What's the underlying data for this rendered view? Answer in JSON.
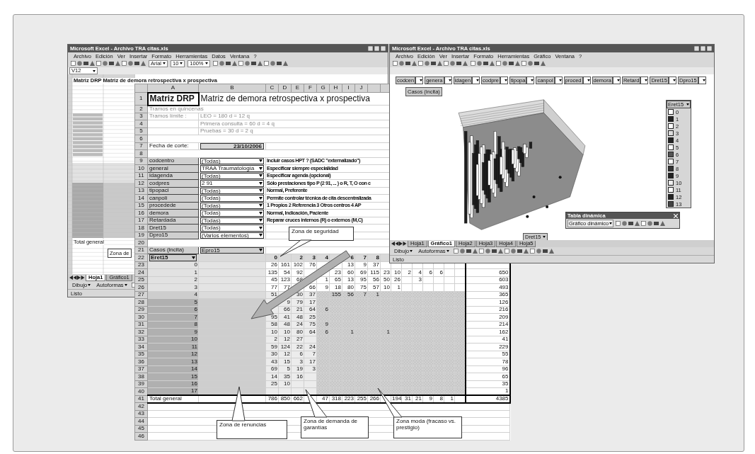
{
  "left_window": {
    "title": "Microsoft Excel - Archivo TRA citas.xls",
    "menu": [
      "Archivo",
      "Edición",
      "Ver",
      "Insertar",
      "Formato",
      "Herramientas",
      "Datos",
      "Ventana",
      "?"
    ],
    "name_box": "V12",
    "font": "Arial",
    "font_size": "10",
    "zoom": "100%",
    "mini_sheet": {
      "title": "Matriz DRP  Matriz de demora retrospectiva x prospectiva",
      "total_label": "Total general",
      "callout": "Zona de"
    },
    "sheet_tabs": [
      {
        "label": "Hoja1",
        "selected": true
      },
      {
        "label": "Gráfico1",
        "selected": false
      }
    ],
    "draw_toolbar": [
      "Dibujo",
      "Autoformas"
    ],
    "status": "Listo"
  },
  "sheet": {
    "columns": [
      "A",
      "B",
      "C",
      "D",
      "E",
      "F",
      "G",
      "H",
      "I",
      "J"
    ],
    "rows": [
      {
        "number": "1",
        "kind": "title",
        "a": "Matriz DRP",
        "b": "Matriz de demora retrospectiva x prospectiva"
      },
      {
        "number": "2",
        "kind": "note",
        "a": "Tramos en quincenas"
      },
      {
        "number": "3",
        "kind": "note",
        "a": "Tramos límite :",
        "b": "LEO = 180 d = 12 q"
      },
      {
        "number": "4",
        "kind": "note",
        "b": "Primera consulta = 60 d = 4 q"
      },
      {
        "number": "5",
        "kind": "note",
        "b": "Pruebas = 30 d = 2 q"
      },
      {
        "number": "6",
        "kind": "blank"
      },
      {
        "number": "7",
        "kind": "date",
        "a": "Fecha de corte:",
        "b": "23/10/2006"
      },
      {
        "number": "8",
        "kind": "blank"
      },
      {
        "number": "9",
        "kind": "filter",
        "a": "codcentro",
        "b": "(Todas)",
        "note": "Incluir casos HPT ? (SADC \"externalizado\")"
      },
      {
        "number": "10",
        "kind": "filter",
        "a": "general",
        "b": "TRAA Traumatología",
        "note": "Especificar siempre especialidad"
      },
      {
        "number": "11",
        "kind": "filter",
        "a": "idagenda",
        "b": "(Todas)",
        "note": "Especificar agenda (opcional)"
      },
      {
        "number": "12",
        "kind": "filter",
        "a": "codpres",
        "b": "2 91",
        "note": "Sólo prestaciones tipo P (2 91, ... ) o R, T, O con c"
      },
      {
        "number": "13",
        "kind": "filter",
        "a": "tipopaci",
        "b": "(Todas)",
        "note": "Normal, Preferente"
      },
      {
        "number": "14",
        "kind": "filter",
        "a": "canpoli",
        "b": "(Todas)",
        "note": "Permite controlar técnica de cita descentralizada"
      },
      {
        "number": "15",
        "kind": "filter",
        "a": "procedede",
        "b": "(Todas)",
        "note": "1 Propios 2 Referencia 3 Otros centros 4 AP"
      },
      {
        "number": "16",
        "kind": "filter",
        "a": "demora",
        "b": "(Todas)",
        "note": "Normal, Indicación, Paciente"
      },
      {
        "number": "17",
        "kind": "filter",
        "a": "Retardada",
        "b": "(Todas)",
        "note": "Reparar cruces internos (R) o externos (M,C)"
      },
      {
        "number": "18",
        "kind": "filter",
        "a": "Dret15",
        "b": "(Todas)"
      },
      {
        "number": "19",
        "kind": "filter",
        "a": "Dpro15",
        "b": "(Varios elementos)"
      },
      {
        "number": "20",
        "kind": "blank"
      },
      {
        "number": "21",
        "kind": "page",
        "a": "Casos (incita)",
        "b": "Epro15"
      },
      {
        "number": "22",
        "kind": "col_head",
        "a": "Eret15",
        "values": {
          "c0": "0",
          "c2": "2",
          "c3": "3",
          "c4": "4",
          "c6": "6",
          "c7": "7",
          "c8": "8"
        }
      },
      {
        "number": "23",
        "kind": "data",
        "a": "0",
        "color": "#e2e2e2",
        "values": {
          "c0": "26",
          "c1": "161",
          "c2": "102",
          "c3": "76",
          "c6": "13",
          "c7": "9",
          "c8": "37"
        }
      },
      {
        "number": "24",
        "kind": "data",
        "a": "1",
        "color": "#e2e2e2",
        "values": {
          "c0": "135",
          "c1": "54",
          "c2": "92",
          "c5": "23",
          "c6": "60",
          "c7": "69",
          "c8": "115",
          "c9": "23",
          "c10": "10",
          "c11": "2",
          "c12": "4",
          "c13": "6",
          "c14": "6"
        },
        "total": "650"
      },
      {
        "number": "25",
        "kind": "data",
        "a": "2",
        "color": "#e2e2e2",
        "values": {
          "c0": "45",
          "c1": "123",
          "c2": "68",
          "c4": "1",
          "c5": "65",
          "c6": "13",
          "c7": "95",
          "c8": "56",
          "c9": "50",
          "c10": "26",
          "c12": "3"
        },
        "total": "603"
      },
      {
        "number": "26",
        "kind": "data",
        "a": "3",
        "color": "#e2e2e2",
        "values": {
          "c0": "77",
          "c1": "77",
          "c3": "66",
          "c4": "9",
          "c5": "18",
          "c6": "80",
          "c7": "75",
          "c8": "57",
          "c9": "10",
          "c10": "1"
        },
        "total": "493"
      },
      {
        "number": "27",
        "kind": "data",
        "a": "4",
        "color": "#cdcdcd",
        "values": {
          "c0": "51",
          "c2": "30",
          "c3": "37",
          "c5": "155",
          "c6": "56",
          "c7": "7",
          "c8": "1"
        },
        "total": "365"
      },
      {
        "number": "28",
        "kind": "data",
        "a": "5",
        "color": "#b0b0b0",
        "values": {
          "c1": "9",
          "c2": "79",
          "c3": "17"
        },
        "total": "126"
      },
      {
        "number": "29",
        "kind": "data",
        "a": "6",
        "color": "#b0b0b0",
        "values": {
          "c1": "66",
          "c2": "21",
          "c3": "64",
          "c4": "6"
        },
        "total": "216"
      },
      {
        "number": "30",
        "kind": "data",
        "a": "7",
        "color": "#b0b0b0",
        "values": {
          "c0": "95",
          "c1": "41",
          "c2": "48",
          "c3": "25"
        },
        "total": "209"
      },
      {
        "number": "31",
        "kind": "data",
        "a": "8",
        "color": "#b0b0b0",
        "values": {
          "c0": "58",
          "c1": "48",
          "c2": "24",
          "c3": "75",
          "c4": "9"
        },
        "total": "214"
      },
      {
        "number": "32",
        "kind": "data",
        "a": "9",
        "color": "#b0b0b0",
        "values": {
          "c0": "10",
          "c1": "10",
          "c2": "80",
          "c3": "64",
          "c4": "6",
          "c6": "1",
          "c9": "1"
        },
        "total": "162"
      },
      {
        "number": "33",
        "kind": "data",
        "a": "10",
        "color": "#b0b0b0",
        "values": {
          "c0": "2",
          "c1": "12",
          "c2": "27"
        },
        "total": "41"
      },
      {
        "number": "34",
        "kind": "data",
        "a": "11",
        "color": "#b0b0b0",
        "values": {
          "c0": "59",
          "c1": "124",
          "c2": "22",
          "c3": "24"
        },
        "total": "229"
      },
      {
        "number": "35",
        "kind": "data",
        "a": "12",
        "color": "#b0b0b0",
        "values": {
          "c0": "30",
          "c1": "12",
          "c2": "6",
          "c3": "7"
        },
        "total": "55"
      },
      {
        "number": "36",
        "kind": "data",
        "a": "13",
        "color": "#b0b0b0",
        "values": {
          "c0": "43",
          "c1": "15",
          "c2": "3",
          "c3": "17"
        },
        "total": "78"
      },
      {
        "number": "37",
        "kind": "data",
        "a": "14",
        "color": "#b0b0b0",
        "values": {
          "c0": "69",
          "c1": "5",
          "c2": "19",
          "c3": "3"
        },
        "total": "96"
      },
      {
        "number": "38",
        "kind": "data",
        "a": "15",
        "color": "#b0b0b0",
        "values": {
          "c0": "14",
          "c1": "35",
          "c2": "16"
        },
        "total": "65"
      },
      {
        "number": "39",
        "kind": "data",
        "a": "16",
        "color": "#b0b0b0",
        "values": {
          "c0": "25",
          "c1": "10"
        },
        "total": "35"
      },
      {
        "number": "40",
        "kind": "data",
        "a": "17",
        "color": "#b0b0b0",
        "total": "1"
      },
      {
        "number": "41",
        "kind": "total",
        "a": "Total general",
        "values": {
          "c0": "786",
          "c1": "850",
          "c2": "662",
          "c4": "47",
          "c5": "318",
          "c6": "223",
          "c7": "255",
          "c8": "266",
          "c10": "194",
          "c11": "31",
          "c12": "21",
          "c13": "9",
          "c14": "8",
          "c15": "1"
        },
        "total": "4385"
      },
      {
        "number": "42",
        "kind": "blank"
      },
      {
        "number": "43",
        "kind": "blank"
      },
      {
        "number": "44",
        "kind": "blank"
      },
      {
        "number": "45",
        "kind": "blank"
      },
      {
        "number": "46",
        "kind": "blank"
      }
    ]
  },
  "right_window": {
    "title": "Microsoft Excel - Archivo TRA citas.xls",
    "menu": [
      "Archivo",
      "Edición",
      "Ver",
      "Insertar",
      "Formato",
      "Herramientas",
      "Gráfico",
      "Ventana",
      "?"
    ],
    "page_fields": [
      "codcen",
      "genera",
      "idagen",
      "codpre",
      "tipopa",
      "canpol",
      "proced",
      "demora",
      "Retard",
      "Dret15",
      "Dpro15"
    ],
    "series_field": "Casos (incita)",
    "legend": {
      "title": "Eret15",
      "items": [
        {
          "label": "0",
          "color": "#ffffff"
        },
        {
          "label": "1",
          "color": "#222222"
        },
        {
          "label": "2",
          "color": "#ffffff"
        },
        {
          "label": "3",
          "color": "#dddddd"
        },
        {
          "label": "4",
          "color": "#222222"
        },
        {
          "label": "5",
          "color": "#ffffff"
        },
        {
          "label": "6",
          "color": "#555555"
        },
        {
          "label": "7",
          "color": "#ffffff"
        },
        {
          "label": "8",
          "color": "#333333"
        },
        {
          "label": "9",
          "color": "#222222"
        },
        {
          "label": "10",
          "color": "#eeeeee"
        },
        {
          "label": "11",
          "color": "#ffffff"
        },
        {
          "label": "12",
          "color": "#222222"
        },
        {
          "label": "13",
          "color": "#444444"
        }
      ]
    },
    "category_field": "Dret15",
    "pivot_toolbar": {
      "title": "Tabla dinámica",
      "menu": "Gráfico dinámico"
    },
    "sheet_tabs": [
      {
        "label": "Hoja1",
        "selected": false
      },
      {
        "label": "Gráfico1",
        "selected": true
      },
      {
        "label": "Hoja2",
        "selected": false
      },
      {
        "label": "Hoja3",
        "selected": false
      },
      {
        "label": "Hoja4",
        "selected": false
      },
      {
        "label": "Hoja5",
        "selected": false
      }
    ],
    "draw_toolbar": [
      "Dibujo",
      "Autoformas"
    ],
    "status": "Listo"
  },
  "callouts": [
    {
      "text": "Zona de seguridad"
    },
    {
      "text": "Zona de renuncias"
    },
    {
      "text": "Zona de demanda de garantías"
    },
    {
      "text": "Zona moda (fracaso vs. prestigio)"
    }
  ]
}
